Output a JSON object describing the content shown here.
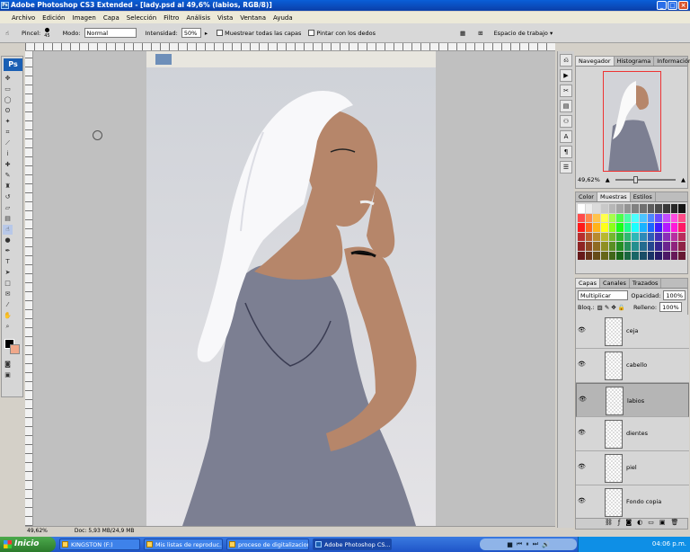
{
  "window": {
    "title": "Adobe Photoshop CS3 Extended - [lady.psd al 49,6% (labios, RGB/8)]",
    "app_icon": "Ps"
  },
  "menu": [
    "Archivo",
    "Edición",
    "Imagen",
    "Capa",
    "Selección",
    "Filtro",
    "Análisis",
    "Vista",
    "Ventana",
    "Ayuda"
  ],
  "options": {
    "brush_label": "Pincel:",
    "brush_size": "45",
    "mode_label": "Modo:",
    "mode_value": "Normal",
    "intensity_label": "Intensidad:",
    "intensity_value": "50%",
    "sample_all_label": "Muestrear todas las capas",
    "finger_paint_label": "Pintar con los dedos",
    "workspace_label": "Espacio de trabajo"
  },
  "toolbox": {
    "logo": "Ps"
  },
  "navigator": {
    "tabs": [
      "Navegador",
      "Histograma",
      "Información"
    ],
    "zoom": "49,62%"
  },
  "swatches": {
    "tabs": [
      "Color",
      "Muestras",
      "Estilos"
    ]
  },
  "layers": {
    "tabs": [
      "Capas",
      "Canales",
      "Trazados"
    ],
    "blend_mode": "Multiplicar",
    "opacity_label": "Opacidad:",
    "opacity_value": "100%",
    "lock_label": "Bloq.:",
    "fill_label": "Relleno:",
    "fill_value": "100%",
    "items": [
      {
        "name": "ceja",
        "selected": false
      },
      {
        "name": "cabello",
        "selected": false
      },
      {
        "name": "labios",
        "selected": true
      },
      {
        "name": "dientes",
        "selected": false
      },
      {
        "name": "piel",
        "selected": false
      },
      {
        "name": "Fondo copia",
        "selected": false
      }
    ]
  },
  "status": {
    "zoom": "49,62%",
    "doc": "Doc: 5,93 MB/24,9 MB"
  },
  "taskbar": {
    "start": "Inicio",
    "tasks": [
      "KINGSTON (F:)",
      "Mis listas de reproduc...",
      "proceso de digitalizacion",
      "Adobe Photoshop CS..."
    ],
    "clock": "04:06 p.m."
  },
  "colors": {
    "titlebar": "#0b4fc8",
    "skin": "#b6866a",
    "dress": "#7c7f92"
  }
}
